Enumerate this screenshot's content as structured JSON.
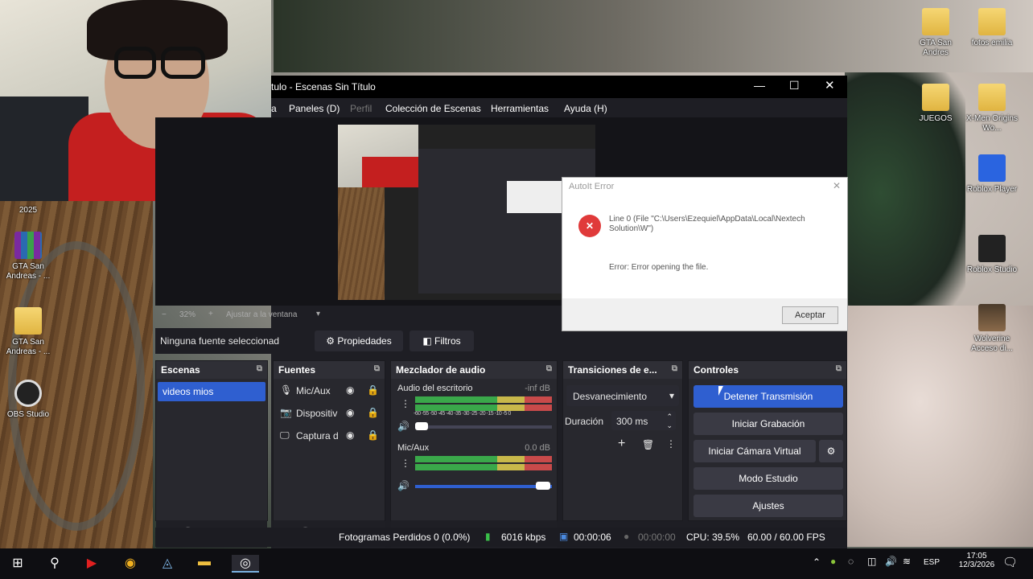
{
  "obs": {
    "title": "tulo - Escenas Sin Título",
    "menu": [
      "a",
      "Paneles (D)",
      "Perfil",
      "Colección de Escenas",
      "Herramientas",
      "Ayuda (H)"
    ],
    "zoom": "32%",
    "zoom_fit": "Ajustar a la ventana",
    "no_source": "Ninguna fuente seleccionad",
    "properties": "Propiedades",
    "filters": "Filtros",
    "docks": {
      "scenes": {
        "title": "Escenas",
        "items": [
          "videos mios"
        ]
      },
      "sources": {
        "title": "Fuentes",
        "items": [
          "Mic/Aux",
          "Dispositiv",
          "Captura d"
        ]
      },
      "mixer": {
        "title": "Mezclador de audio",
        "channels": [
          {
            "name": "Audio del escritorio",
            "db": "-inf dB"
          },
          {
            "name": "Mic/Aux",
            "db": "0.0 dB",
            "level": 1.0
          }
        ],
        "scale": "-60 -55 -50 -45 -40 -35 -30 -25 -20 -15 -10 -5 0"
      },
      "transitions": {
        "title": "Transiciones de e...",
        "selected": "Desvanecimiento",
        "duration_label": "Duración",
        "duration": "300 ms"
      },
      "controls": {
        "title": "Controles",
        "stop_stream": "Detener Transmisión",
        "start_record": "Iniciar Grabación",
        "virtual_cam": "Iniciar Cámara Virtual",
        "studio_mode": "Modo Estudio",
        "settings": "Ajustes"
      }
    },
    "status": {
      "dropped": "Fotogramas Perdidos 0 (0.0%)",
      "bitrate": "6016 kbps",
      "stream_time": "00:00:06",
      "rec_time": "00:00:00",
      "cpu": "CPU: 39.5%",
      "fps": "60.00 / 60.00 FPS"
    }
  },
  "dialog": {
    "title": "AutoIt Error",
    "line": "Line 0  (File \"C:\\Users\\Ezequiel\\AppData\\Local\\Nextech Solution\\W\")",
    "error": "Error: Error opening the file.",
    "accept": "Aceptar"
  },
  "desktop_icons": {
    "left": [
      {
        "label": "2025"
      },
      {
        "label": "GTA San Andreas - ..."
      },
      {
        "label": "GTA San Andreas - ..."
      },
      {
        "label": "OBS Studio"
      }
    ],
    "right": [
      {
        "label": "GTA San Andres"
      },
      {
        "label": "fotos emilia"
      },
      {
        "label": "JUEGOS"
      },
      {
        "label": "X-Men Origins Wo..."
      },
      {
        "label": "Roblox Player"
      },
      {
        "label": "Roblox Studio"
      },
      {
        "label": "Wolverine Acceso di..."
      }
    ]
  },
  "taskbar": {
    "lang": "ESP",
    "time": "17:05",
    "date": "12/3/2026"
  },
  "colors": {
    "accent": "#2f5fd0",
    "obs_bg": "#1e1e24",
    "dock": "#28282e"
  }
}
